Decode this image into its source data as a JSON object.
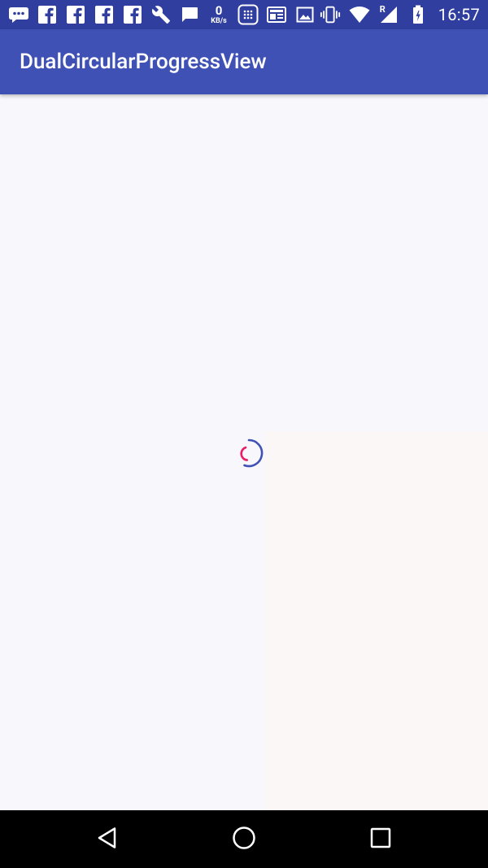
{
  "status_bar": {
    "network_speed_value": "0",
    "network_speed_unit": "KB/s",
    "roaming_indicator": "R",
    "time": "16:57",
    "icons_left": [
      "chat-bubble-icon",
      "facebook-icon",
      "facebook-icon",
      "facebook-icon",
      "facebook-icon",
      "wrench-icon",
      "message-icon",
      "network-speed",
      "keypad-icon",
      "newspaper-icon",
      "image-icon"
    ],
    "icons_right": [
      "vibrate-icon",
      "wifi-icon",
      "cell-signal-icon",
      "battery-icon"
    ]
  },
  "app_bar": {
    "title": "DualCircularProgressView"
  },
  "progress": {
    "outer_color": "#3f51b5",
    "inner_color": "#e91e63"
  },
  "nav_bar": {
    "buttons": [
      "back-icon",
      "home-icon",
      "recents-icon"
    ]
  }
}
